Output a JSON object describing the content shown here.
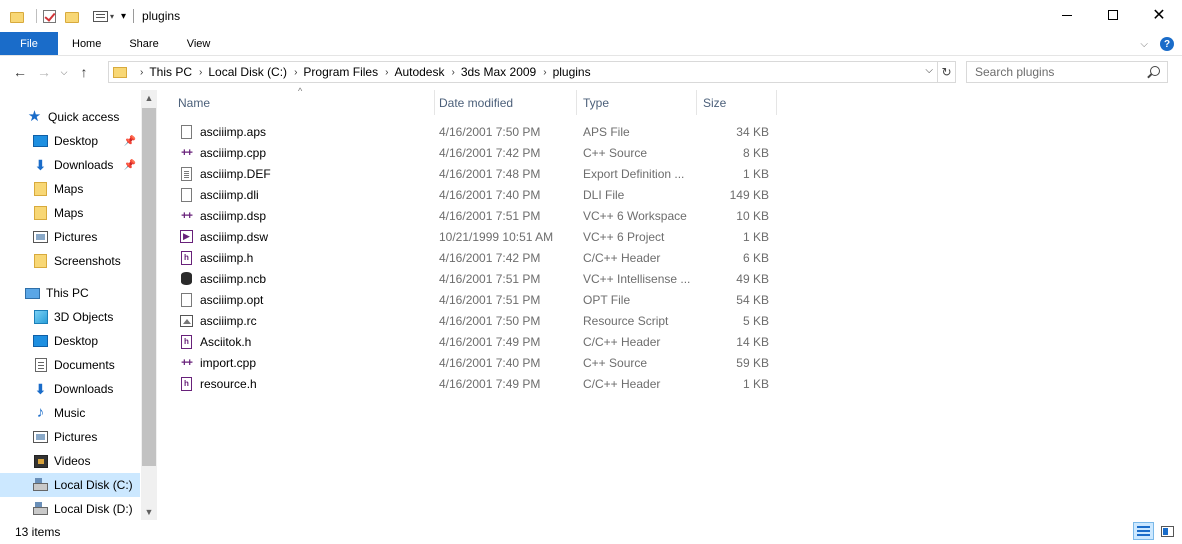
{
  "window": {
    "title": "plugins"
  },
  "ribbon": {
    "tabs": [
      "File",
      "Home",
      "Share",
      "View"
    ]
  },
  "address": {
    "crumbs": [
      "This PC",
      "Local Disk (C:)",
      "Program Files",
      "Autodesk",
      "3ds Max 2009",
      "plugins"
    ]
  },
  "search": {
    "placeholder": "Search plugins"
  },
  "navpane": {
    "items": [
      {
        "label": "Quick access",
        "icon": "star-icon"
      },
      {
        "label": "Desktop",
        "icon": "desktop-icon",
        "pinned": true
      },
      {
        "label": "Downloads",
        "icon": "download-icon",
        "pinned": true
      },
      {
        "label": "Maps",
        "icon": "folder-icon"
      },
      {
        "label": "Maps",
        "icon": "folder-icon"
      },
      {
        "label": "Pictures",
        "icon": "pictures-icon"
      },
      {
        "label": "Screenshots",
        "icon": "folder-icon"
      },
      {
        "label": "This PC",
        "icon": "computer-icon"
      },
      {
        "label": "3D Objects",
        "icon": "3d-objects-icon"
      },
      {
        "label": "Desktop",
        "icon": "desktop-icon"
      },
      {
        "label": "Documents",
        "icon": "documents-icon"
      },
      {
        "label": "Downloads",
        "icon": "download-icon"
      },
      {
        "label": "Music",
        "icon": "music-icon"
      },
      {
        "label": "Pictures",
        "icon": "pictures-icon"
      },
      {
        "label": "Videos",
        "icon": "videos-icon"
      },
      {
        "label": "Local Disk (C:)",
        "icon": "drive-icon",
        "selected": true
      },
      {
        "label": "Local Disk (D:)",
        "icon": "drive-icon"
      }
    ]
  },
  "columns": {
    "name": "Name",
    "date": "Date modified",
    "type": "Type",
    "size": "Size"
  },
  "files": [
    {
      "name": "asciiimp.aps",
      "date": "4/16/2001 7:50 PM",
      "type": "APS File",
      "size": "34 KB",
      "icon": "generic-file-icon"
    },
    {
      "name": "asciiimp.cpp",
      "date": "4/16/2001 7:42 PM",
      "type": "C++ Source",
      "size": "8 KB",
      "icon": "cpp-file-icon"
    },
    {
      "name": "asciiimp.DEF",
      "date": "4/16/2001 7:48 PM",
      "type": "Export Definition ...",
      "size": "1 KB",
      "icon": "text-file-icon"
    },
    {
      "name": "asciiimp.dli",
      "date": "4/16/2001 7:40 PM",
      "type": "DLI File",
      "size": "149 KB",
      "icon": "generic-file-icon"
    },
    {
      "name": "asciiimp.dsp",
      "date": "4/16/2001 7:51 PM",
      "type": "VC++ 6 Workspace",
      "size": "10 KB",
      "icon": "cpp-file-icon"
    },
    {
      "name": "asciiimp.dsw",
      "date": "10/21/1999 10:51 AM",
      "type": "VC++ 6 Project",
      "size": "1 KB",
      "icon": "vs-project-icon"
    },
    {
      "name": "asciiimp.h",
      "date": "4/16/2001 7:42 PM",
      "type": "C/C++ Header",
      "size": "6 KB",
      "icon": "header-file-icon"
    },
    {
      "name": "asciiimp.ncb",
      "date": "4/16/2001 7:51 PM",
      "type": "VC++ Intellisense ...",
      "size": "49 KB",
      "icon": "database-icon"
    },
    {
      "name": "asciiimp.opt",
      "date": "4/16/2001 7:51 PM",
      "type": "OPT File",
      "size": "54 KB",
      "icon": "generic-file-icon"
    },
    {
      "name": "asciiimp.rc",
      "date": "4/16/2001 7:50 PM",
      "type": "Resource Script",
      "size": "5 KB",
      "icon": "resource-file-icon"
    },
    {
      "name": "Asciitok.h",
      "date": "4/16/2001 7:49 PM",
      "type": "C/C++ Header",
      "size": "14 KB",
      "icon": "header-file-icon"
    },
    {
      "name": "import.cpp",
      "date": "4/16/2001 7:40 PM",
      "type": "C++ Source",
      "size": "59 KB",
      "icon": "cpp-file-icon"
    },
    {
      "name": "resource.h",
      "date": "4/16/2001 7:49 PM",
      "type": "C/C++ Header",
      "size": "1 KB",
      "icon": "header-file-icon"
    }
  ],
  "status": {
    "item_count": "13 items"
  },
  "colors": {
    "accent": "#1a6cc9",
    "selected_bg": "#cce8ff",
    "header_text": "#4c607a",
    "secondary_text": "#6d6d6d"
  }
}
